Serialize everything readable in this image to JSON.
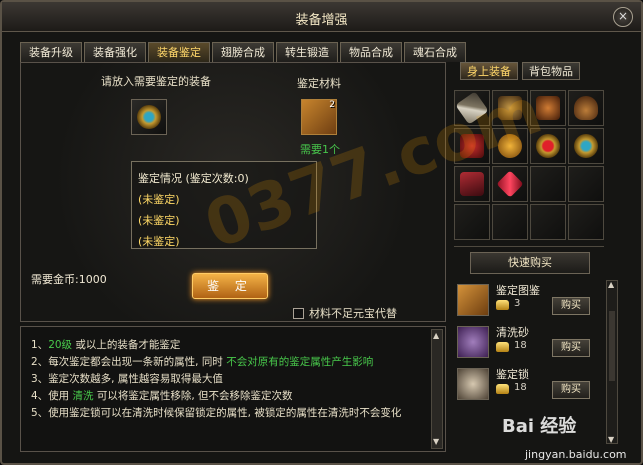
{
  "window": {
    "title": "装备增强",
    "close": "×"
  },
  "tabs": [
    {
      "label": "装备升级"
    },
    {
      "label": "装备强化"
    },
    {
      "label": "装备鉴定"
    },
    {
      "label": "翅膀合成"
    },
    {
      "label": "转生锻造"
    },
    {
      "label": "物品合成"
    },
    {
      "label": "魂石合成"
    }
  ],
  "identify": {
    "prompt": "请放入需要鉴定的装备",
    "material_label": "鉴定材料",
    "material_qty": "2",
    "need_text": "需要1个",
    "status_title": "鉴定情况 (鉴定次数:0)",
    "status_lines": [
      "(未鉴定)",
      "(未鉴定)",
      "(未鉴定)"
    ],
    "gold_label": "需要金币:1000",
    "button_label": "鉴 定",
    "checkbox_label": "材料不足元宝代替"
  },
  "instructions": [
    {
      "num": "1、",
      "a": "",
      "highlight": "20级",
      "b": " 或以上的装备才能鉴定",
      "highlight2": "",
      "c": ""
    },
    {
      "num": "2、",
      "a": "每次鉴定都会出现一条新的属性, 同时",
      "highlight": " 不会对原有的鉴定属性产生影响",
      "b": "",
      "highlight2": "",
      "c": ""
    },
    {
      "num": "3、",
      "a": "鉴定次数越多, 属性越容易取得最大值",
      "highlight": "",
      "b": "",
      "highlight2": "",
      "c": ""
    },
    {
      "num": "4、",
      "a": "使用 ",
      "highlight": "清洗",
      "b": " 可以将鉴定属性移除, 但不会移除鉴定次数",
      "highlight2": "",
      "c": ""
    },
    {
      "num": "5、",
      "a": "使用鉴定锁可以在清洗时候保留锁定的属性, 被锁定的属性在清洗时不会变化",
      "highlight": "",
      "b": "",
      "highlight2": "",
      "c": ""
    }
  ],
  "side_tabs": [
    {
      "label": "身上装备"
    },
    {
      "label": "背包物品"
    }
  ],
  "inventory_icons": [
    "sword-icon",
    "armor-icon",
    "armor-red-icon",
    "helmet-icon",
    "belt-icon",
    "necklace-icon",
    "ring-icon",
    "ring-blue-icon",
    "boots-icon",
    "gem-icon"
  ],
  "quick_buy": {
    "label": "快速购买",
    "items": [
      {
        "name": "鉴定图鉴",
        "price": "3",
        "buy": "购买"
      },
      {
        "name": "清洗砂",
        "price": "18",
        "buy": "购买"
      },
      {
        "name": "鉴定锁",
        "price": "18",
        "buy": "购买"
      }
    ]
  },
  "watermark": {
    "logo": "0377.com",
    "site_small": "Bai 经验",
    "url": "jingyan.baidu.com"
  },
  "colors": {
    "accent": "#ffd76a",
    "highlight": "#48c84b",
    "button": "#f4b347"
  }
}
